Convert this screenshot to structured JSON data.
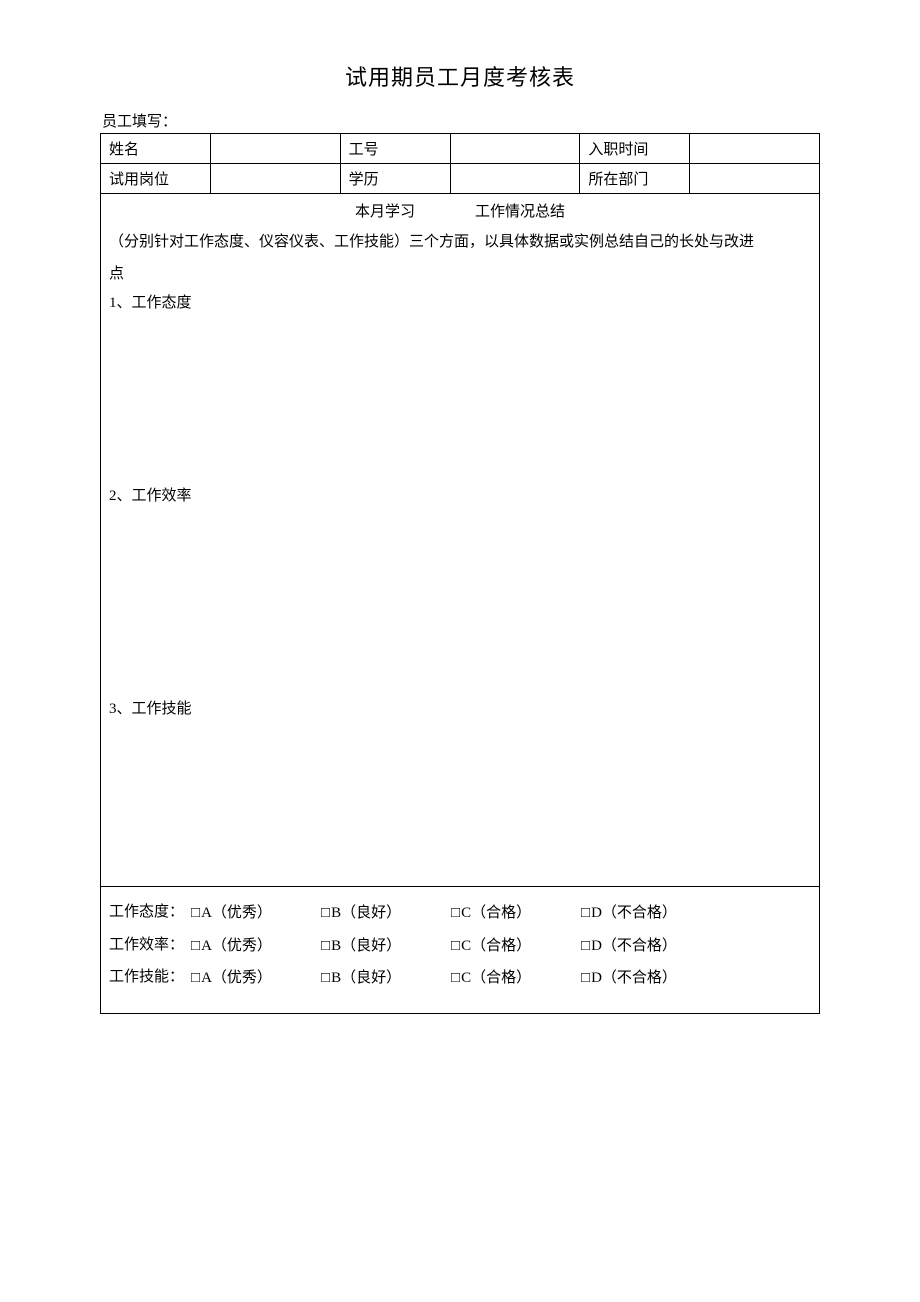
{
  "title": "试用期员工月度考核表",
  "fillerLabel": "员工填写：",
  "info": {
    "nameLabel": "姓名",
    "nameValue": "",
    "idLabel": "工号",
    "idValue": "",
    "hireDateLabel": "入职时间",
    "hireDateValue": "",
    "positionLabel": "试用岗位",
    "positionValue": "",
    "educationLabel": "学历",
    "educationValue": "",
    "departmentLabel": "所在部门",
    "departmentValue": ""
  },
  "summary": {
    "headerLeft": "本月学习",
    "headerRight": "工作情况总结",
    "desc1": "（分别针对工作态度、仪容仪表、工作技能）三个方面，以具体数据或实例总结自己的长处与改进",
    "desc2": "点",
    "section1": "1、工作态度",
    "section2": "2、工作效率",
    "section3": "3、工作技能"
  },
  "ratings": {
    "items": [
      {
        "label": "工作态度：",
        "a": "A（优秀）",
        "b": "B（良好）",
        "c": "C（合格）",
        "d": "D（不合格）"
      },
      {
        "label": "工作效率：",
        "a": "A（优秀）",
        "b": "B（良好）",
        "c": "C（合格）",
        "d": "D（不合格）"
      },
      {
        "label": "工作技能：",
        "a": "A（优秀）",
        "b": "B（良好）",
        "c": "C（合格）",
        "d": "D（不合格）"
      }
    ],
    "checkbox": "□"
  }
}
